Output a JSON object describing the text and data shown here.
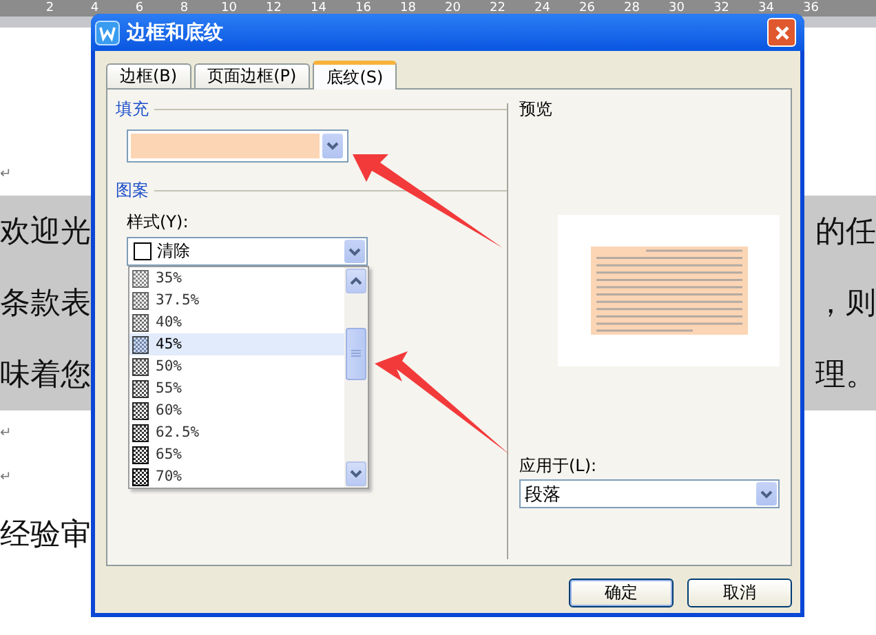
{
  "document": {
    "ruler": [
      "2",
      "4",
      "6",
      "8",
      "10",
      "12",
      "14",
      "16",
      "18",
      "20",
      "22",
      "24",
      "26",
      "28",
      "30",
      "32",
      "34",
      "36"
    ],
    "lines": [
      {
        "kind": "mark",
        "text": "↵"
      },
      {
        "kind": "text",
        "left": "欢迎光",
        "right": "的任",
        "shaded": true
      },
      {
        "kind": "text",
        "left": "条款表",
        "right": "，则",
        "shaded": true
      },
      {
        "kind": "text",
        "left": "味着您",
        "right": "理。",
        "shaded": true
      },
      {
        "kind": "mark",
        "text": "↵"
      },
      {
        "kind": "mark",
        "text": "↵"
      },
      {
        "kind": "text",
        "left": "经验审",
        "shaded": false
      }
    ]
  },
  "dialog": {
    "title": "边框和底纹",
    "tabs": [
      {
        "label": "边框(B)",
        "selected": false
      },
      {
        "label": "页面边框(P)",
        "selected": false
      },
      {
        "label": "底纹(S)",
        "selected": true
      }
    ],
    "fill": {
      "label": "填充",
      "color": "#fcd5b4"
    },
    "pattern": {
      "label": "图案",
      "style_label": "样式(Y):",
      "style_value": "清除",
      "options": [
        {
          "label": "35%",
          "selected": false
        },
        {
          "label": "37.5%",
          "selected": false
        },
        {
          "label": "40%",
          "selected": false
        },
        {
          "label": "45%",
          "selected": true
        },
        {
          "label": "50%",
          "selected": false
        },
        {
          "label": "55%",
          "selected": false
        },
        {
          "label": "60%",
          "selected": false
        },
        {
          "label": "62.5%",
          "selected": false
        },
        {
          "label": "65%",
          "selected": false
        },
        {
          "label": "70%",
          "selected": false
        }
      ]
    },
    "preview": {
      "label": "预览"
    },
    "apply_to": {
      "label": "应用于(L):",
      "value": "段落"
    },
    "buttons": [
      "确定",
      "取消"
    ]
  }
}
